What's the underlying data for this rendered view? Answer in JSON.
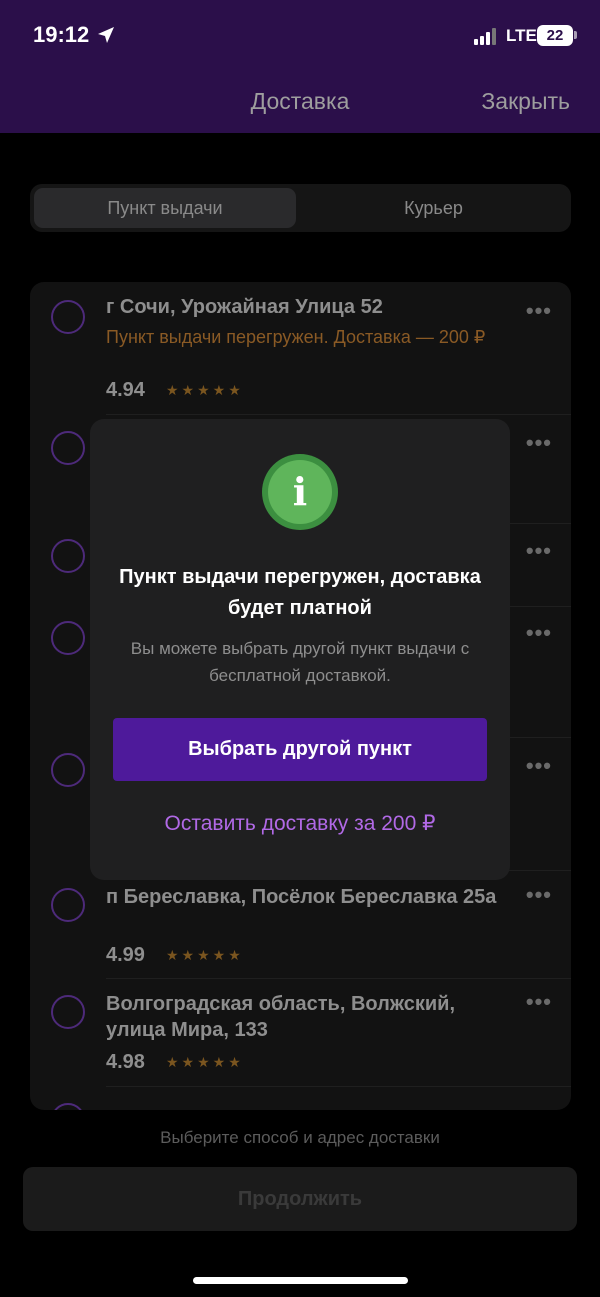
{
  "status_bar": {
    "time": "19:12",
    "network": "LTE",
    "battery": "22"
  },
  "header": {
    "title": "Доставка",
    "close_label": "Закрыть"
  },
  "tabs": [
    {
      "label": "Пункт выдачи",
      "active": true
    },
    {
      "label": "Курьер",
      "active": false
    }
  ],
  "pickup_points": [
    {
      "address": "г Сочи, Урожайная Улица 52",
      "warning": "Пункт выдачи перегружен. Доставка — 200 ₽",
      "rating": "4.94",
      "stars": "★★★★★"
    },
    {
      "address": "п Береславка, Посёлок Береславка 25а",
      "rating": "4.99",
      "stars": "★★★★★"
    },
    {
      "address": "Волгоградская область, Волжский, улица Мира, 133",
      "rating": "4.98",
      "stars": "★★★★★"
    }
  ],
  "dialog": {
    "icon": "info-icon",
    "icon_glyph": "i",
    "title": "Пункт выдачи перегружен, доставка будет платной",
    "text": "Вы можете выбрать другой пункт выдачи с бесплатной доставкой.",
    "primary_label": "Выбрать другой пункт",
    "secondary_label": "Оставить доставку за 200 ₽"
  },
  "footer": {
    "hint": "Выберите способ и адрес доставки",
    "continue_label": "Продолжить"
  },
  "more_icon_glyph": "•••",
  "colors": {
    "header_bg": "#2b0f4a",
    "accent": "#4e1a9b",
    "link": "#b169e6",
    "warning": "#8a5a25",
    "info_green": "#5fb55b"
  }
}
